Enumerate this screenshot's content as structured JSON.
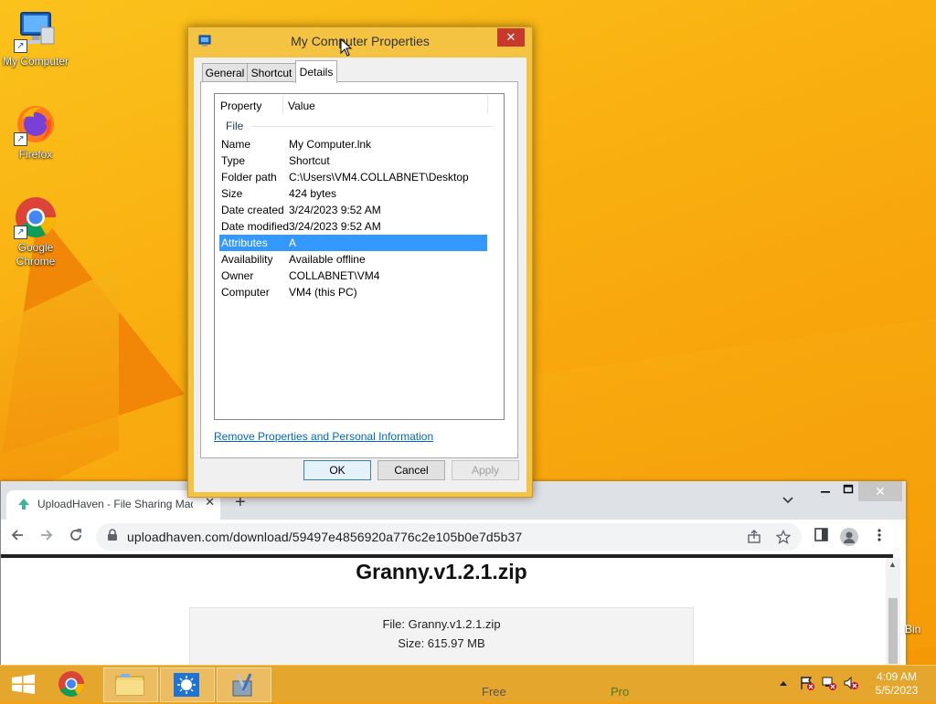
{
  "desktop": {
    "icons": [
      {
        "label": "My Computer"
      },
      {
        "label": "Firefox"
      },
      {
        "label": "Google Chrome"
      }
    ],
    "partial_label": "Bin"
  },
  "dialog": {
    "title": "My Computer Properties",
    "close_glyph": "✕",
    "tabs": [
      "General",
      "Shortcut",
      "Details"
    ],
    "active_tab": "Details",
    "columns": {
      "property": "Property",
      "value": "Value"
    },
    "group": "File",
    "rows": [
      {
        "k": "Name",
        "v": "My Computer.lnk"
      },
      {
        "k": "Type",
        "v": "Shortcut"
      },
      {
        "k": "Folder path",
        "v": "C:\\Users\\VM4.COLLABNET\\Desktop"
      },
      {
        "k": "Size",
        "v": "424 bytes"
      },
      {
        "k": "Date created",
        "v": "3/24/2023 9:52 AM"
      },
      {
        "k": "Date modified",
        "v": "3/24/2023 9:52 AM"
      },
      {
        "k": "Attributes",
        "v": "A"
      },
      {
        "k": "Availability",
        "v": "Available offline"
      },
      {
        "k": "Owner",
        "v": "COLLABNET\\VM4"
      },
      {
        "k": "Computer",
        "v": "VM4 (this PC)"
      }
    ],
    "selected_row": "Attributes",
    "remove_link": "Remove Properties and Personal Information",
    "buttons": {
      "ok": "OK",
      "cancel": "Cancel",
      "apply": "Apply"
    }
  },
  "browser": {
    "tab_title": "UploadHaven - File Sharing Made",
    "tab_close": "✕",
    "new_tab": "+",
    "url": "uploadhaven.com/download/59497e4856920a776c2e105b0e7d5b37",
    "page": {
      "heading": "Granny.v1.2.1.zip",
      "file_line": "File: Granny.v1.2.1.zip",
      "size_line": "Size: 615.97 MB",
      "plan_free": "Free",
      "plan_pro": "Pro"
    }
  },
  "taskbar": {
    "time": "4:09 AM",
    "date": "5/5/2023"
  },
  "colors": {
    "selection": "#3399ff",
    "link": "#0066cc",
    "title_close": "#c7392a"
  }
}
